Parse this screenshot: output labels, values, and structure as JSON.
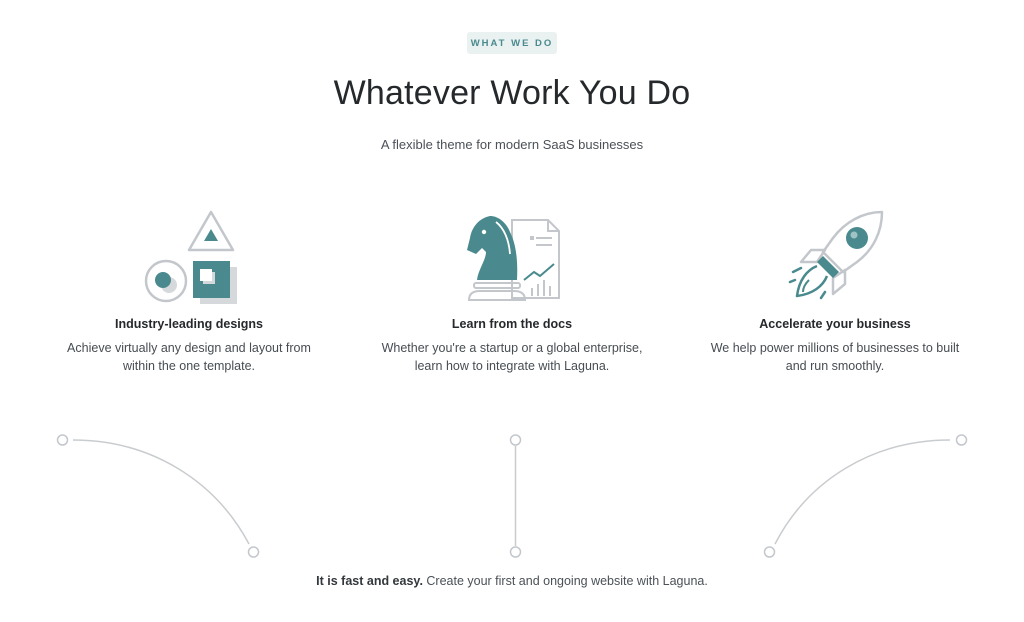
{
  "section": {
    "badge": "WHAT WE DO",
    "title": "Whatever Work You Do",
    "subtitle": "A flexible theme for modern SaaS businesses"
  },
  "features": [
    {
      "icon": "shapes-icon",
      "title": "Industry-leading designs",
      "description": "Achieve virtually any design and layout from within the one template."
    },
    {
      "icon": "chess-knight-icon",
      "title": "Learn from the docs",
      "description": "Whether you're a startup or a global enterprise, learn how to integrate with Laguna."
    },
    {
      "icon": "rocket-icon",
      "title": "Accelerate your business",
      "description": "We help power millions of businesses to built and run smoothly."
    }
  ],
  "footer": {
    "bold": "It is fast and easy.",
    "text": " Create your first and ongoing website with Laguna."
  },
  "colors": {
    "accent": "#4a8a8e",
    "outline": "#c3c7cc",
    "badge_bg": "#e9f1f1"
  }
}
